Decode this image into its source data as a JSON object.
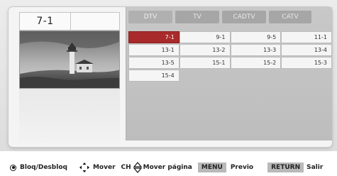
{
  "channel": {
    "number": "7-1"
  },
  "tabs": [
    "DTV",
    "TV",
    "CADTV",
    "CATV"
  ],
  "grid": [
    [
      "7-1",
      "9-1",
      "9-5",
      "11-1"
    ],
    [
      "13-1",
      "13-2",
      "13-3",
      "13-4"
    ],
    [
      "13-5",
      "15-1",
      "15-2",
      "15-3"
    ],
    [
      "15-4",
      "",
      "",
      ""
    ]
  ],
  "selected": "7-1",
  "legend": {
    "lock": "Bloq/Desbloq",
    "move": "Mover",
    "ch": "CH",
    "move_page": "Mover página",
    "menu_key": "MENU",
    "menu_label": "Previo",
    "return_key": "RETURN",
    "return_label": "Salir"
  },
  "colors": {
    "selected": "#a82a2a",
    "panel": "#c2c2c2"
  }
}
